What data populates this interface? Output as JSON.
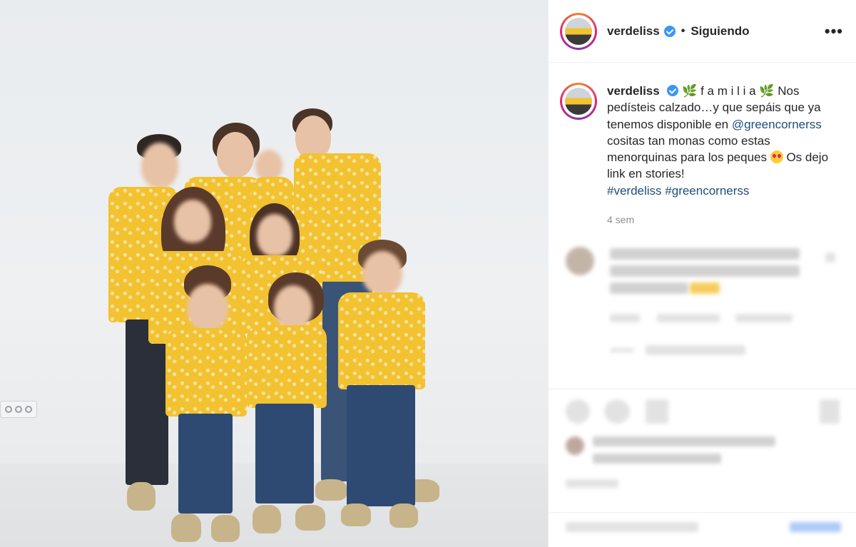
{
  "header": {
    "username": "verdeliss",
    "separator": "•",
    "follow_status": "Siguiendo",
    "more_icon": "more-options-icon",
    "more_label": "•••"
  },
  "caption": {
    "username": "verdeliss",
    "leaf_emoji": "🌿",
    "title": "f a m i l i a",
    "line_part1": "Nos pedísteis calzado…y que sepáis que ya tenemos disponible en",
    "mention": "@greencornerss",
    "line_part2": "cositas tan monas como estas menorquinas para los peques",
    "line_part3": "Os dejo link en stories!",
    "hashtag1": "#verdeliss",
    "hashtag2": "#greencornerss",
    "time": "4 sem"
  },
  "colors": {
    "link": "#1e4d7b",
    "verified": "#3897f0",
    "shirt_yellow": "#f2c230"
  }
}
